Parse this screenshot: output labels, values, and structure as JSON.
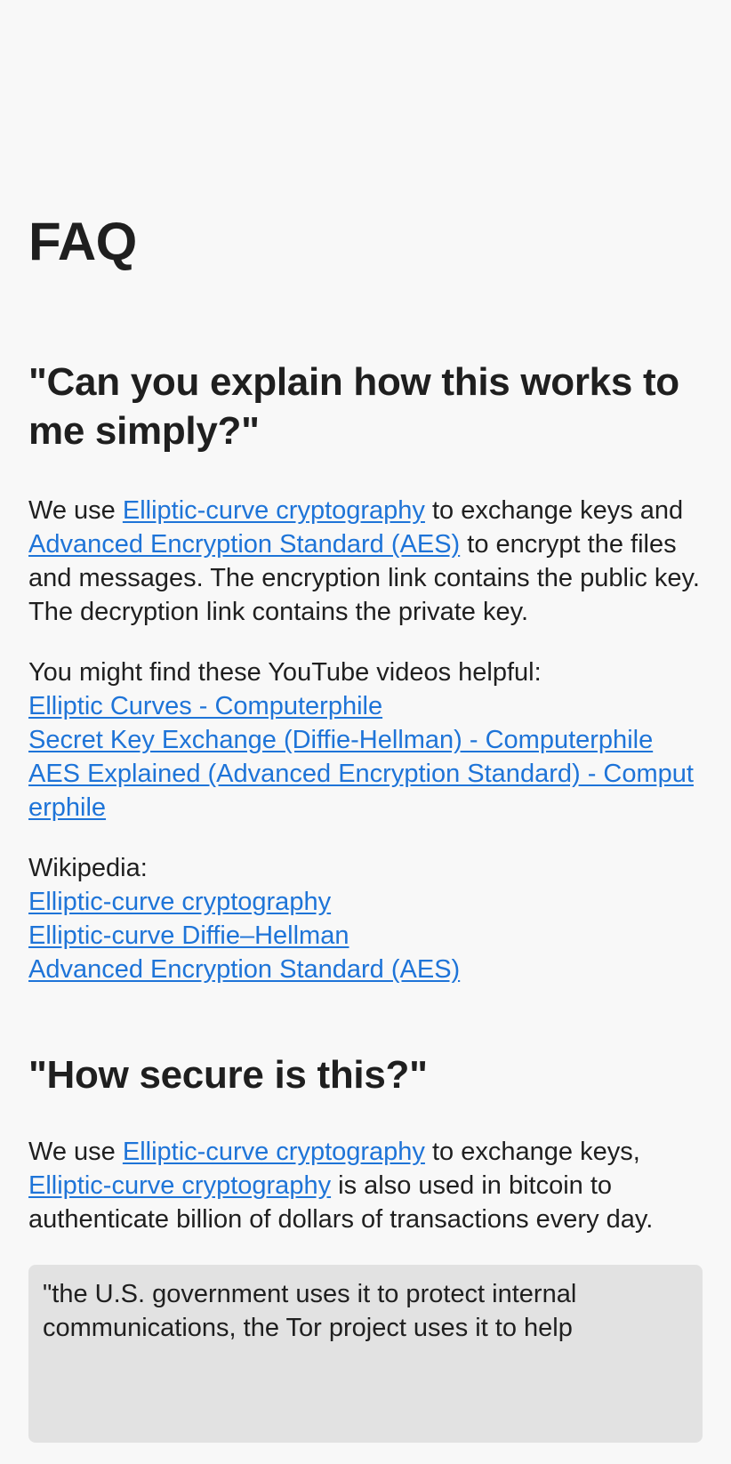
{
  "page": {
    "title": "FAQ"
  },
  "q1": {
    "heading": "\"Can you explain how this works to me simply?\"",
    "intro": {
      "t1": "We use ",
      "link1": "Elliptic-curve cryptography",
      "t2": " to exchange keys and ",
      "link2": "Advanced Encryption Standard (AES)",
      "t3": " to encrypt the files and messages. The encryption link contains the public key. The decryption link contains the private key."
    },
    "videos_label": "You might find these YouTube videos helpful:",
    "videos": [
      "Elliptic Curves - Computerphile",
      "Secret Key Exchange (Diffie-Hellman) - Computerphile",
      "AES Explained (Advanced Encryption Standard) - Computerphile"
    ],
    "wiki_label": "Wikipedia:",
    "wiki": [
      "Elliptic-curve cryptography",
      "Elliptic-curve Diffie–Hellman",
      "Advanced Encryption Standard (AES)"
    ]
  },
  "q2": {
    "heading": "\"How secure is this?\"",
    "para": {
      "t1": "We use ",
      "link1": "Elliptic-curve cryptography",
      "t2": " to exchange keys, ",
      "link2": "Elliptic-curve cryptography",
      "t3": " is also used in bitcoin to authenticate billion of dollars of transactions every day."
    },
    "quote": "\"the U.S. government uses it to protect internal communications, the Tor project uses it to help"
  },
  "colors": {
    "background": "#f8f8f8",
    "text": "#1f1f1f",
    "link": "#1e74d8",
    "quote_bg": "#e2e2e2"
  }
}
